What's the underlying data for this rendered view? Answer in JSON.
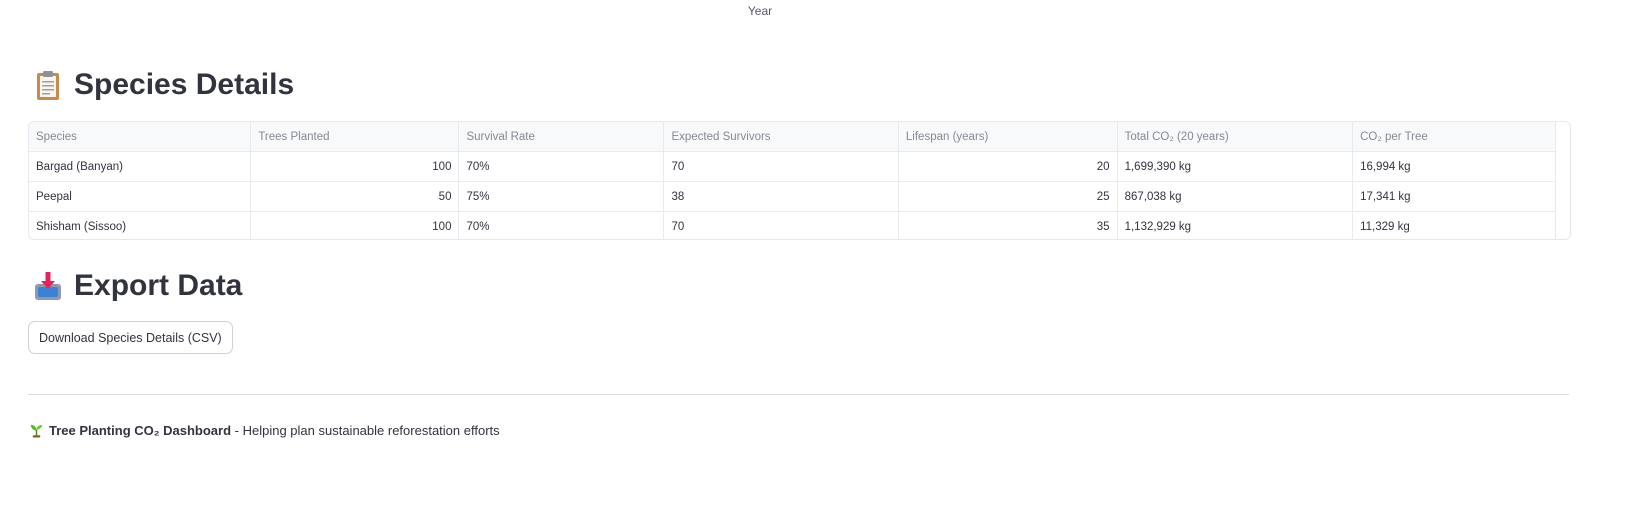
{
  "chart_axis": {
    "x_label": "Year"
  },
  "species_section": {
    "heading": "Species Details",
    "icon": "clipboard-icon"
  },
  "table": {
    "columns": [
      "Species",
      "Trees Planted",
      "Survival Rate",
      "Expected Survivors",
      "Lifespan (years)",
      "Total CO₂ (20 years)",
      "CO₂ per Tree"
    ],
    "rows": [
      [
        "Bargad (Banyan)",
        "100",
        "70%",
        "70",
        "20",
        "1,699,390 kg",
        "16,994 kg"
      ],
      [
        "Peepal",
        "50",
        "75%",
        "38",
        "25",
        "867,038 kg",
        "17,341 kg"
      ],
      [
        "Shisham (Sissoo)",
        "100",
        "70%",
        "70",
        "35",
        "1,132,929 kg",
        "11,329 kg"
      ]
    ]
  },
  "export_section": {
    "heading": "Export Data",
    "icon": "inbox-tray-icon",
    "download_label": "Download Species Details (CSV)"
  },
  "footer": {
    "icon": "seedling-icon",
    "title": "Tree Planting CO₂ Dashboard",
    "tagline": " - Helping plan sustainable reforestation efforts"
  }
}
